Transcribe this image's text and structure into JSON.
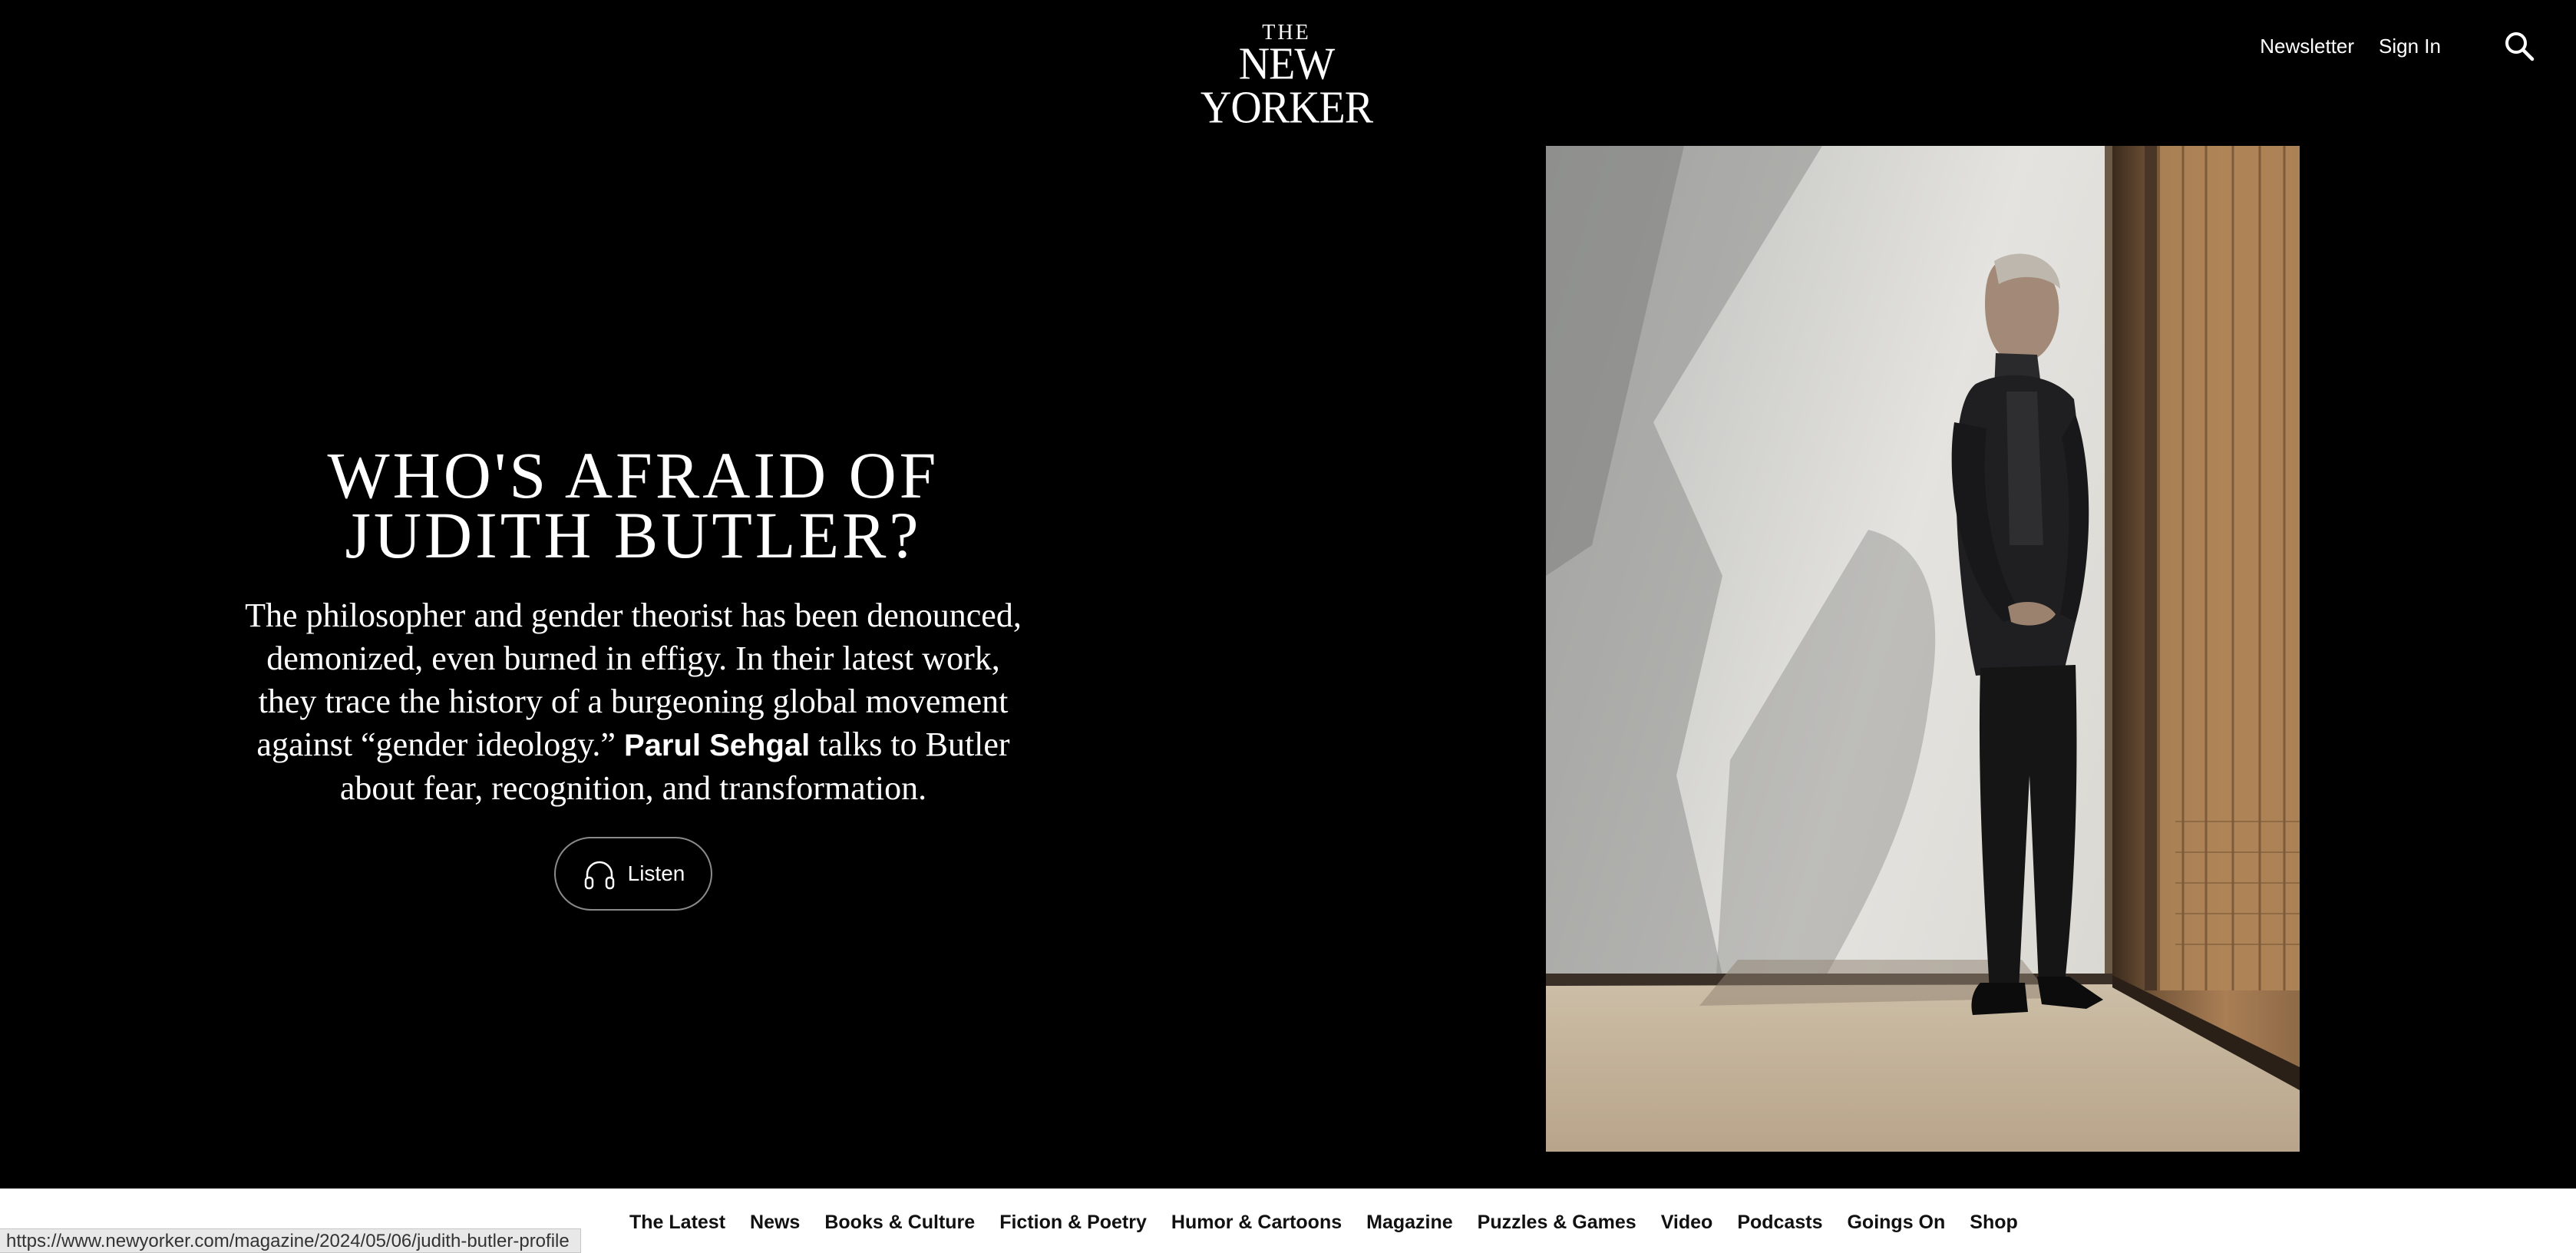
{
  "header": {
    "logo_the": "THE",
    "logo_name": "NEW YORKER",
    "links": [
      "Newsletter",
      "Sign In"
    ],
    "search_icon": "search-icon"
  },
  "hero": {
    "headline": "WHO'S AFRAID OF JUDITH BUTLER?",
    "dek_before": "The philosopher and gender theorist has been denounced, demonized, even burned in effigy. In their latest work, they trace the history of a burgeoning global movement against “gender ideology.” ",
    "author": "Parul Sehgal",
    "dek_after": " talks to Butler about fear, recognition, and transformation.",
    "listen_label": "Listen",
    "listen_icon": "headphones-icon"
  },
  "nav": {
    "items": [
      "The Latest",
      "News",
      "Books & Culture",
      "Fiction & Poetry",
      "Humor & Cartoons",
      "Magazine",
      "Puzzles & Games",
      "Video",
      "Podcasts",
      "Goings On",
      "Shop"
    ]
  },
  "status_bar": {
    "url": "https://www.newyorker.com/magazine/2024/05/06/judith-butler-profile"
  },
  "colors": {
    "background": "#000000",
    "text": "#ffffff",
    "nav_background": "#ffffff",
    "nav_text": "#111111"
  }
}
